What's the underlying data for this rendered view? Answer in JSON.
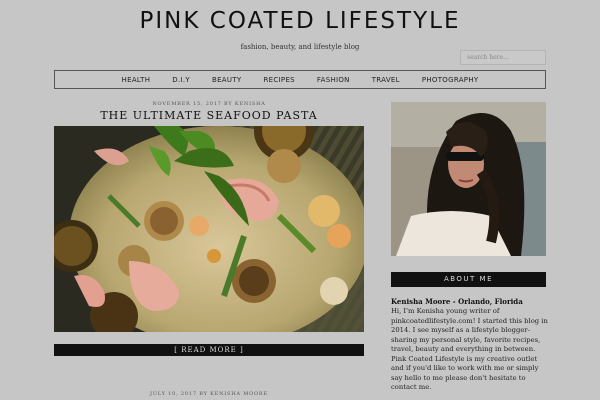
{
  "site": {
    "title": "PINK COATED LIFESTYLE",
    "tagline": "fashion, beauty, and lifestyle blog"
  },
  "search": {
    "placeholder": "search here..."
  },
  "nav": [
    "HEALTH",
    "D.I.Y",
    "BEAUTY",
    "RECIPES",
    "FASHION",
    "TRAVEL",
    "PHOTOGRAPHY"
  ],
  "posts": [
    {
      "meta": "NOVEMBER 15, 2017 BY  KENISHA",
      "title": "THE ULTIMATE SEAFOOD PASTA",
      "read_more": "[ READ MORE ]"
    },
    {
      "meta": "JULY 10, 2017 BY  KENISHA MOORE"
    }
  ],
  "sidebar": {
    "about_heading": "ABOUT ME",
    "about_name": "Kenisha Moore - Orlando, Florida",
    "about_text": "Hi, I'm Kenisha young writer of pinkcoatedlifestyle.com! I started this blog in 2014. I see myself as a lifestyle blogger- sharing my personal style, favorite recipes, travel, beauty and everything in between. Pink Coated Lifestyle is my creative outlet and if you'd like to work with me or simply say hello to me please don't hesitate to contact me."
  }
}
